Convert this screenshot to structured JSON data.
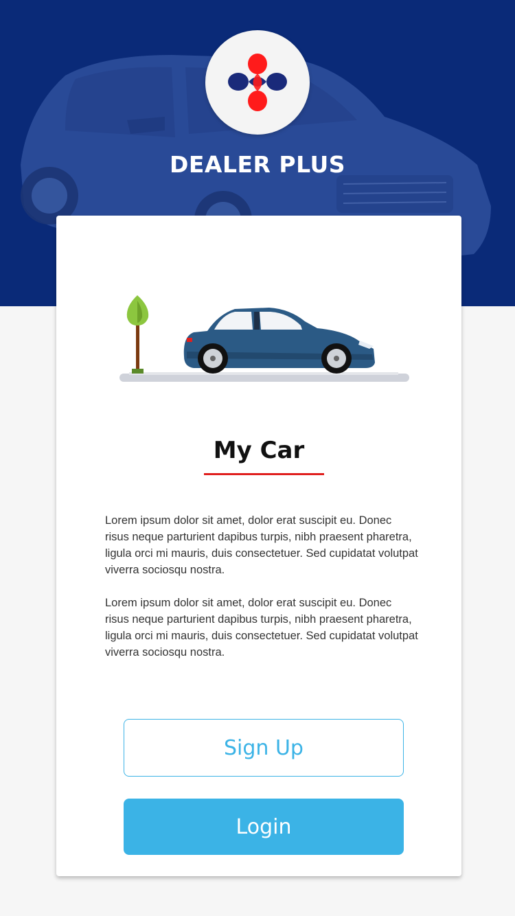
{
  "header": {
    "brand_name": "DEALER PLUS",
    "logo_icon": "dealer-plus-logo-icon",
    "background_color": "#0a2a78"
  },
  "card": {
    "illustration_icon": "car-illustration-icon",
    "title": "My Car",
    "accent_color": "#e0201e",
    "paragraphs": [
      "Lorem ipsum dolor sit amet, dolor erat suscipit eu. Donec risus neque parturient dapibus turpis, nibh praesent pharetra, ligula orci mi mauris, duis consectetuer. Sed cupidatat volutpat viverra sociosqu nostra.",
      "Lorem ipsum dolor sit amet, dolor erat suscipit eu. Donec risus neque parturient dapibus turpis, nibh praesent pharetra, ligula orci mi mauris, duis consectetuer. Sed cupidatat volutpat viverra sociosqu nostra."
    ]
  },
  "buttons": {
    "signup_label": "Sign Up",
    "login_label": "Login",
    "primary_color": "#3bb3e6"
  }
}
